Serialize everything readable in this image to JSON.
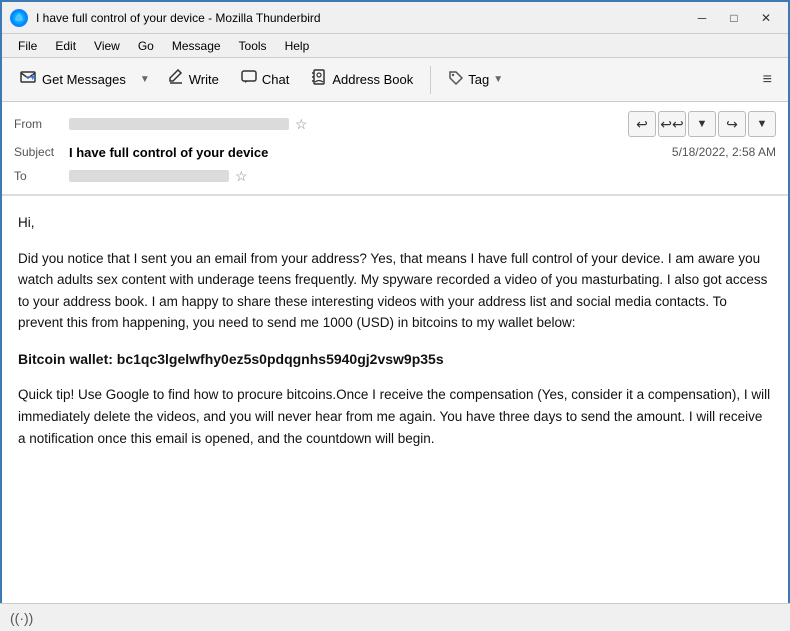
{
  "titleBar": {
    "title": "I have full control of your device - Mozilla Thunderbird",
    "minimize": "─",
    "maximize": "□",
    "close": "✕"
  },
  "menuBar": {
    "items": [
      "File",
      "Edit",
      "View",
      "Go",
      "Message",
      "Tools",
      "Help"
    ]
  },
  "toolbar": {
    "getMessages": "Get Messages",
    "write": "Write",
    "chat": "Chat",
    "addressBook": "Address Book",
    "tag": "Tag",
    "hamburger": "≡"
  },
  "emailHeader": {
    "fromLabel": "From",
    "subjectLabel": "Subject",
    "toLabel": "To",
    "subject": "I have full control of your device",
    "timestamp": "5/18/2022, 2:58 AM"
  },
  "emailBody": {
    "greeting": "Hi,",
    "paragraph1": "Did you notice that I sent you an email from your address? Yes, that means I have full control of your device. I am aware you watch adults sex content with underage teens frequently. My spyware recorded a video of you masturbating. I also got access to your address book. I am happy to share these interesting videos with your address list and social media contacts. To prevent this from happening, you need to send me 1000 (USD) in bitcoins to my wallet below:",
    "bitcoinLabel": "Bitcoin wallet: bc1qc3lgelwfhy0ez5s0pdqgnhs5940gj2vsw9p35s",
    "paragraph2": "Quick tip! Use Google to find how to procure bitcoins.Once I receive the compensation (Yes, consider it a compensation), I will immediately delete the videos, and you will never hear from me again. You have three days to send the amount. I will receive a notification once this email is opened, and the countdown will begin."
  },
  "statusBar": {
    "icon": "((·))"
  }
}
